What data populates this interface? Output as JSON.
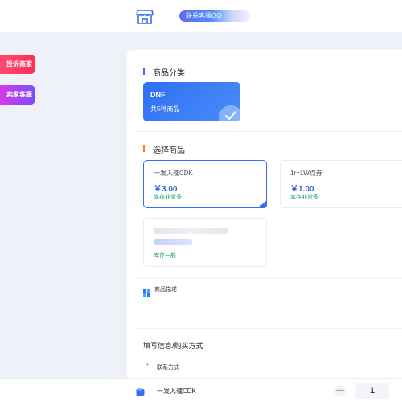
{
  "header": {
    "store_icon": "store-icon",
    "kefu_label": "联系客服QQ"
  },
  "side": {
    "complain_label": "投诉商家",
    "seller_label": "卖家客服"
  },
  "category_section": {
    "title": "商品分类",
    "items": [
      {
        "name": "DNF",
        "count_text": "共5种商品",
        "selected": true
      }
    ]
  },
  "product_section": {
    "title": "选择商品",
    "items": [
      {
        "name": "一发入魂CDK",
        "price": "￥3.00",
        "stock": "库存非常多",
        "selected": true
      },
      {
        "name": "1r=1W点券",
        "price": "￥1.00",
        "stock": "库存非常多",
        "selected": false
      },
      {
        "name": "",
        "price": "",
        "stock": "库存一般",
        "selected": false
      }
    ]
  },
  "description": {
    "icon": "grid-icon",
    "label": "商品描述"
  },
  "fill_section": {
    "title": "填写信息/购买方式",
    "required_mark": "*",
    "contact_label": "联系方式"
  },
  "bottom_bar": {
    "product_name": "一发入魂CDK",
    "minus_label": "—",
    "quantity": "1"
  },
  "colors": {
    "accent": "#3a6cf6",
    "price": "#2f5fd8",
    "stock": "#1ba25b",
    "complain": "#ff2d55",
    "seller": "#7b4dfa"
  }
}
